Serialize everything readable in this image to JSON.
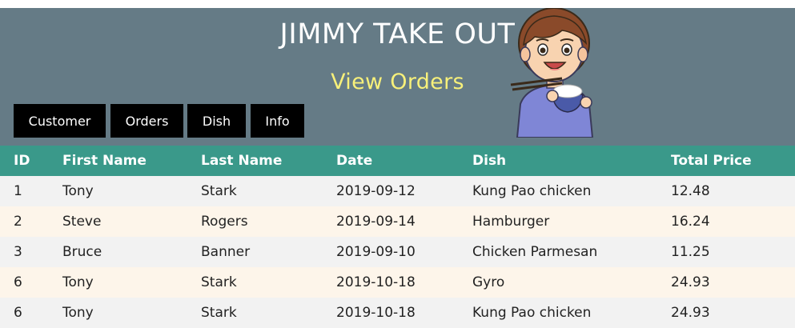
{
  "header": {
    "title": "JIMMY TAKE OUT",
    "subtitle": "View Orders",
    "background_color": "#657b86",
    "subtitle_color": "#f7f07a"
  },
  "mascot": {
    "icon": "cartoon-boy-eating-rice-icon"
  },
  "nav": {
    "items": [
      "Customer",
      "Orders",
      "Dish",
      "Info"
    ]
  },
  "table": {
    "header_color": "#3a998a",
    "columns": [
      "ID",
      "First Name",
      "Last Name",
      "Date",
      "Dish",
      "Total Price"
    ],
    "rows": [
      [
        "1",
        "Tony",
        "Stark",
        "2019-09-12",
        "Kung Pao chicken",
        "12.48"
      ],
      [
        "2",
        "Steve",
        "Rogers",
        "2019-09-14",
        "Hamburger",
        "16.24"
      ],
      [
        "3",
        "Bruce",
        "Banner",
        "2019-09-10",
        "Chicken Parmesan",
        "11.25"
      ],
      [
        "6",
        "Tony",
        "Stark",
        "2019-10-18",
        "Gyro",
        "24.93"
      ],
      [
        "6",
        "Tony",
        "Stark",
        "2019-10-18",
        "Kung Pao chicken",
        "24.93"
      ]
    ]
  }
}
